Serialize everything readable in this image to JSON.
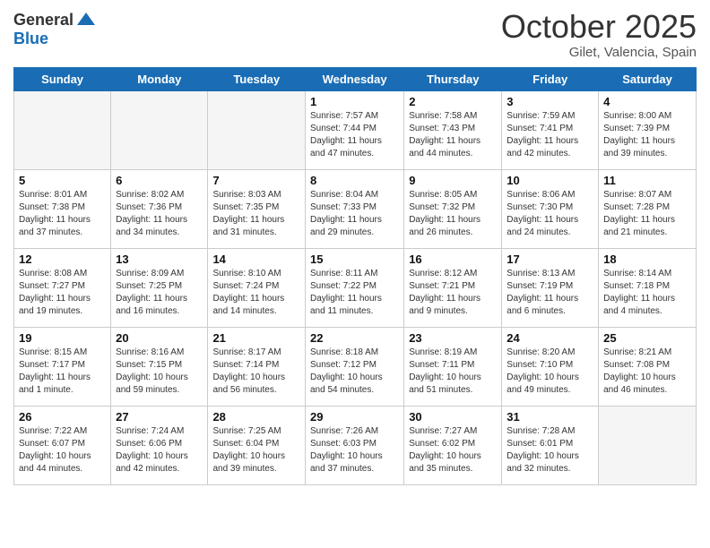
{
  "logo": {
    "general": "General",
    "blue": "Blue"
  },
  "title": "October 2025",
  "location": "Gilet, Valencia, Spain",
  "days_of_week": [
    "Sunday",
    "Monday",
    "Tuesday",
    "Wednesday",
    "Thursday",
    "Friday",
    "Saturday"
  ],
  "weeks": [
    [
      {
        "num": "",
        "info": ""
      },
      {
        "num": "",
        "info": ""
      },
      {
        "num": "",
        "info": ""
      },
      {
        "num": "1",
        "info": "Sunrise: 7:57 AM\nSunset: 7:44 PM\nDaylight: 11 hours\nand 47 minutes."
      },
      {
        "num": "2",
        "info": "Sunrise: 7:58 AM\nSunset: 7:43 PM\nDaylight: 11 hours\nand 44 minutes."
      },
      {
        "num": "3",
        "info": "Sunrise: 7:59 AM\nSunset: 7:41 PM\nDaylight: 11 hours\nand 42 minutes."
      },
      {
        "num": "4",
        "info": "Sunrise: 8:00 AM\nSunset: 7:39 PM\nDaylight: 11 hours\nand 39 minutes."
      }
    ],
    [
      {
        "num": "5",
        "info": "Sunrise: 8:01 AM\nSunset: 7:38 PM\nDaylight: 11 hours\nand 37 minutes."
      },
      {
        "num": "6",
        "info": "Sunrise: 8:02 AM\nSunset: 7:36 PM\nDaylight: 11 hours\nand 34 minutes."
      },
      {
        "num": "7",
        "info": "Sunrise: 8:03 AM\nSunset: 7:35 PM\nDaylight: 11 hours\nand 31 minutes."
      },
      {
        "num": "8",
        "info": "Sunrise: 8:04 AM\nSunset: 7:33 PM\nDaylight: 11 hours\nand 29 minutes."
      },
      {
        "num": "9",
        "info": "Sunrise: 8:05 AM\nSunset: 7:32 PM\nDaylight: 11 hours\nand 26 minutes."
      },
      {
        "num": "10",
        "info": "Sunrise: 8:06 AM\nSunset: 7:30 PM\nDaylight: 11 hours\nand 24 minutes."
      },
      {
        "num": "11",
        "info": "Sunrise: 8:07 AM\nSunset: 7:28 PM\nDaylight: 11 hours\nand 21 minutes."
      }
    ],
    [
      {
        "num": "12",
        "info": "Sunrise: 8:08 AM\nSunset: 7:27 PM\nDaylight: 11 hours\nand 19 minutes."
      },
      {
        "num": "13",
        "info": "Sunrise: 8:09 AM\nSunset: 7:25 PM\nDaylight: 11 hours\nand 16 minutes."
      },
      {
        "num": "14",
        "info": "Sunrise: 8:10 AM\nSunset: 7:24 PM\nDaylight: 11 hours\nand 14 minutes."
      },
      {
        "num": "15",
        "info": "Sunrise: 8:11 AM\nSunset: 7:22 PM\nDaylight: 11 hours\nand 11 minutes."
      },
      {
        "num": "16",
        "info": "Sunrise: 8:12 AM\nSunset: 7:21 PM\nDaylight: 11 hours\nand 9 minutes."
      },
      {
        "num": "17",
        "info": "Sunrise: 8:13 AM\nSunset: 7:19 PM\nDaylight: 11 hours\nand 6 minutes."
      },
      {
        "num": "18",
        "info": "Sunrise: 8:14 AM\nSunset: 7:18 PM\nDaylight: 11 hours\nand 4 minutes."
      }
    ],
    [
      {
        "num": "19",
        "info": "Sunrise: 8:15 AM\nSunset: 7:17 PM\nDaylight: 11 hours\nand 1 minute."
      },
      {
        "num": "20",
        "info": "Sunrise: 8:16 AM\nSunset: 7:15 PM\nDaylight: 10 hours\nand 59 minutes."
      },
      {
        "num": "21",
        "info": "Sunrise: 8:17 AM\nSunset: 7:14 PM\nDaylight: 10 hours\nand 56 minutes."
      },
      {
        "num": "22",
        "info": "Sunrise: 8:18 AM\nSunset: 7:12 PM\nDaylight: 10 hours\nand 54 minutes."
      },
      {
        "num": "23",
        "info": "Sunrise: 8:19 AM\nSunset: 7:11 PM\nDaylight: 10 hours\nand 51 minutes."
      },
      {
        "num": "24",
        "info": "Sunrise: 8:20 AM\nSunset: 7:10 PM\nDaylight: 10 hours\nand 49 minutes."
      },
      {
        "num": "25",
        "info": "Sunrise: 8:21 AM\nSunset: 7:08 PM\nDaylight: 10 hours\nand 46 minutes."
      }
    ],
    [
      {
        "num": "26",
        "info": "Sunrise: 7:22 AM\nSunset: 6:07 PM\nDaylight: 10 hours\nand 44 minutes."
      },
      {
        "num": "27",
        "info": "Sunrise: 7:24 AM\nSunset: 6:06 PM\nDaylight: 10 hours\nand 42 minutes."
      },
      {
        "num": "28",
        "info": "Sunrise: 7:25 AM\nSunset: 6:04 PM\nDaylight: 10 hours\nand 39 minutes."
      },
      {
        "num": "29",
        "info": "Sunrise: 7:26 AM\nSunset: 6:03 PM\nDaylight: 10 hours\nand 37 minutes."
      },
      {
        "num": "30",
        "info": "Sunrise: 7:27 AM\nSunset: 6:02 PM\nDaylight: 10 hours\nand 35 minutes."
      },
      {
        "num": "31",
        "info": "Sunrise: 7:28 AM\nSunset: 6:01 PM\nDaylight: 10 hours\nand 32 minutes."
      },
      {
        "num": "",
        "info": ""
      }
    ]
  ],
  "shaded_rows": [
    1,
    3
  ],
  "colors": {
    "header_bg": "#1a6db5",
    "shaded_row": "#f0f0f0",
    "empty_cell": "#f5f5f5"
  }
}
